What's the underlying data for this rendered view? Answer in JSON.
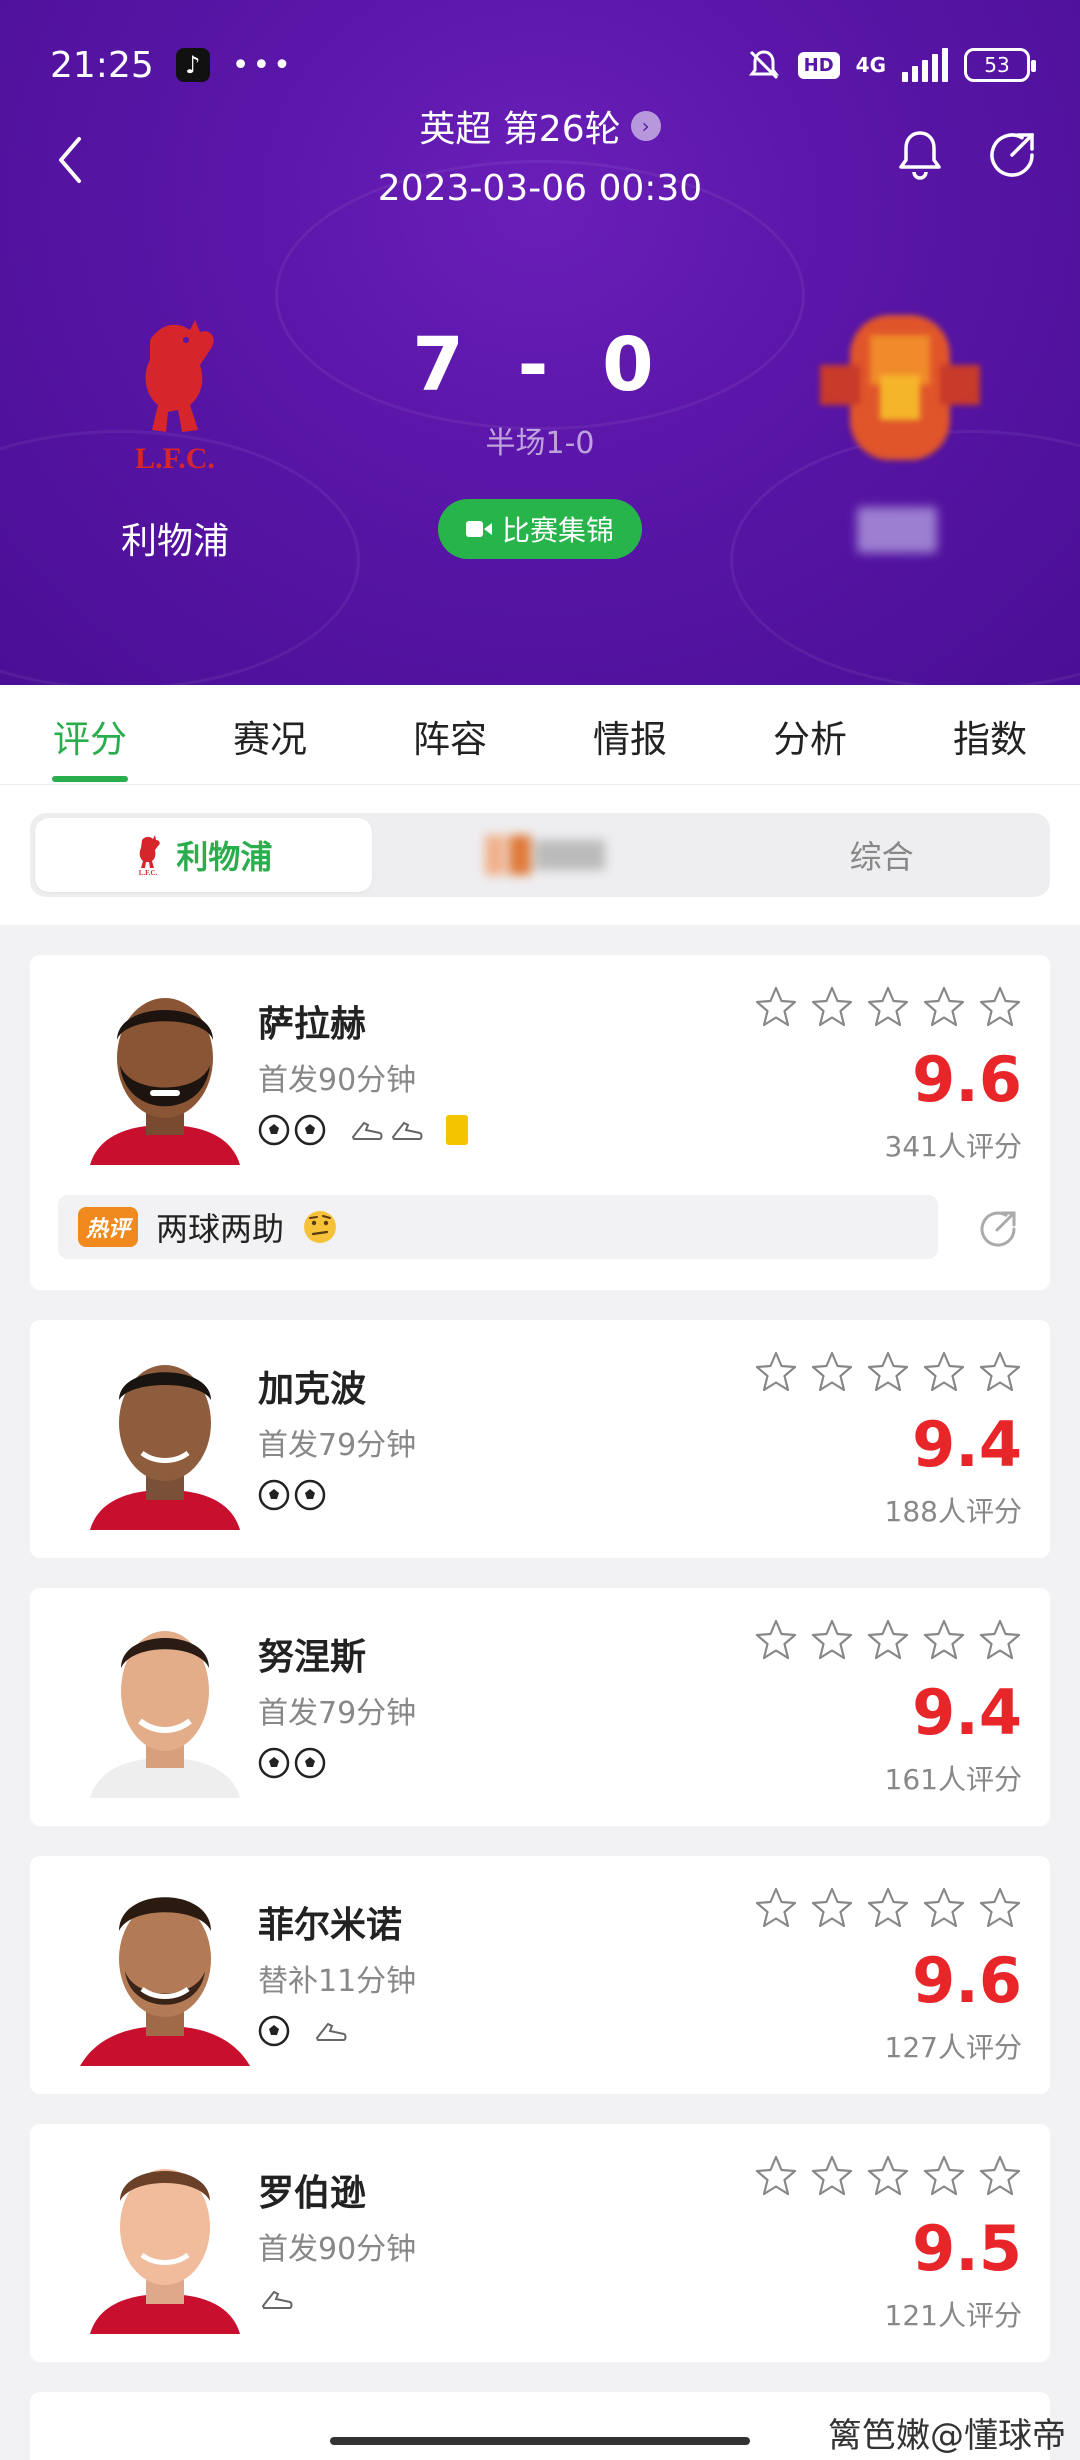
{
  "status_bar": {
    "time": "21:25",
    "app_glyph": "♪",
    "hd": "HD",
    "network": "4G",
    "battery": "53"
  },
  "header": {
    "round_title": "英超 第26轮",
    "date": "2023-03-06 00:30",
    "home": {
      "name": "利物浦",
      "logo_text": "L.F.C."
    },
    "score": "7 - 0",
    "half_score": "半场1-0",
    "highlights_label": "比赛集锦"
  },
  "tabs": [
    "评分",
    "赛况",
    "阵容",
    "情报",
    "分析",
    "指数"
  ],
  "team_switch": {
    "home_label": "利物浦",
    "combined_label": "综合"
  },
  "players": [
    {
      "name": "萨拉赫",
      "minutes": "首发90分钟",
      "goals": 2,
      "assists": 2,
      "yellow_cards": 1,
      "rating": "9.6",
      "votes": "341人评分",
      "hot_badge": "热评",
      "hot_comment": "两球两助"
    },
    {
      "name": "加克波",
      "minutes": "首发79分钟",
      "goals": 2,
      "assists": 0,
      "yellow_cards": 0,
      "rating": "9.4",
      "votes": "188人评分"
    },
    {
      "name": "努涅斯",
      "minutes": "首发79分钟",
      "goals": 2,
      "assists": 0,
      "yellow_cards": 0,
      "rating": "9.4",
      "votes": "161人评分"
    },
    {
      "name": "菲尔米诺",
      "minutes": "替补11分钟",
      "goals": 1,
      "assists": 1,
      "yellow_cards": 0,
      "rating": "9.6",
      "votes": "127人评分"
    },
    {
      "name": "罗伯逊",
      "minutes": "首发90分钟",
      "goals": 0,
      "assists": 1,
      "yellow_cards": 0,
      "rating": "9.5",
      "votes": "121人评分"
    }
  ],
  "watermark": "篱笆嫩@懂球帝",
  "colors": {
    "header": "#5a16a8",
    "accent_green": "#2aae4d",
    "rating_red": "#e8262a",
    "liverpool_red": "#d6262b",
    "hot_orange": "#f08a1e"
  },
  "icons": [
    "back-arrow-icon",
    "bell-icon",
    "share-icon",
    "video-icon",
    "football-icon",
    "boot-icon",
    "yellow-card-icon",
    "star-icon",
    "thinking-emoji-icon"
  ]
}
